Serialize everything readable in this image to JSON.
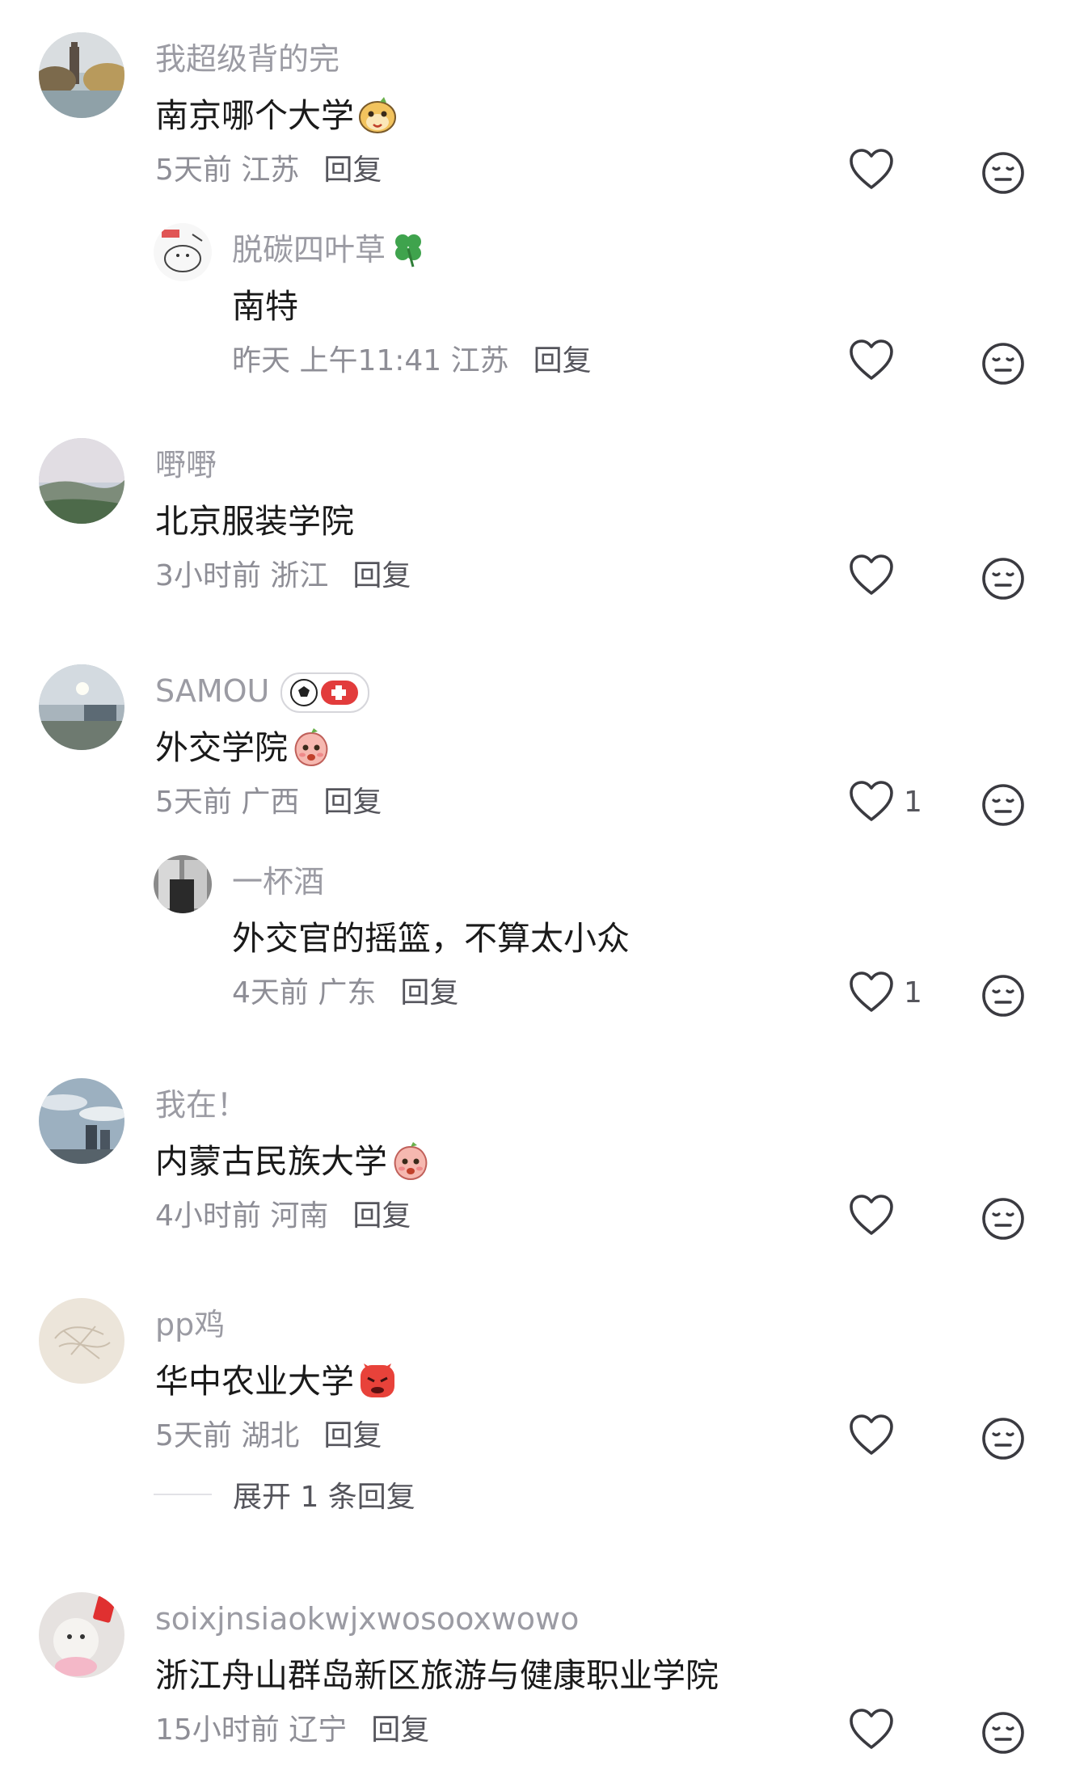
{
  "comments": [
    {
      "username": "我超级背的完",
      "text": "南京哪个大学",
      "time": "5天前",
      "location": "江苏",
      "reply": "回复",
      "likes": ""
    },
    {
      "username": "脱碳四叶草",
      "text": "南特",
      "time": "昨天 上午11:41",
      "location": "江苏",
      "reply": "回复",
      "likes": ""
    },
    {
      "username": "嘢嘢",
      "text": "北京服装学院",
      "time": "3小时前",
      "location": "浙江",
      "reply": "回复",
      "likes": ""
    },
    {
      "username": "SAMOU",
      "text": "外交学院",
      "time": "5天前",
      "location": "广西",
      "reply": "回复",
      "likes": "1"
    },
    {
      "username": "一杯酒",
      "text": "外交官的摇篮，不算太小众",
      "time": "4天前",
      "location": "广东",
      "reply": "回复",
      "likes": "1"
    },
    {
      "username": "我在！",
      "text": "内蒙古民族大学",
      "time": "4小时前",
      "location": "河南",
      "reply": "回复",
      "likes": ""
    },
    {
      "username": "pp鸡",
      "text": "华中农业大学",
      "time": "5天前",
      "location": "湖北",
      "reply": "回复",
      "likes": ""
    },
    {
      "username": "soixjnsiaokwjxwosooxwowo",
      "text": "浙江舟山群岛新区旅游与健康职业学院",
      "time": "15小时前",
      "location": "辽宁",
      "reply": "回复",
      "likes": ""
    }
  ],
  "expand_replies": "展开 1 条回复",
  "icons": {
    "like": "heart-outline-icon",
    "dislike": "meh-face-icon"
  },
  "colors": {
    "username": "#9b9ba3",
    "text": "#1a1a1a",
    "meta": "#8e8e96",
    "reply": "#55555c"
  }
}
